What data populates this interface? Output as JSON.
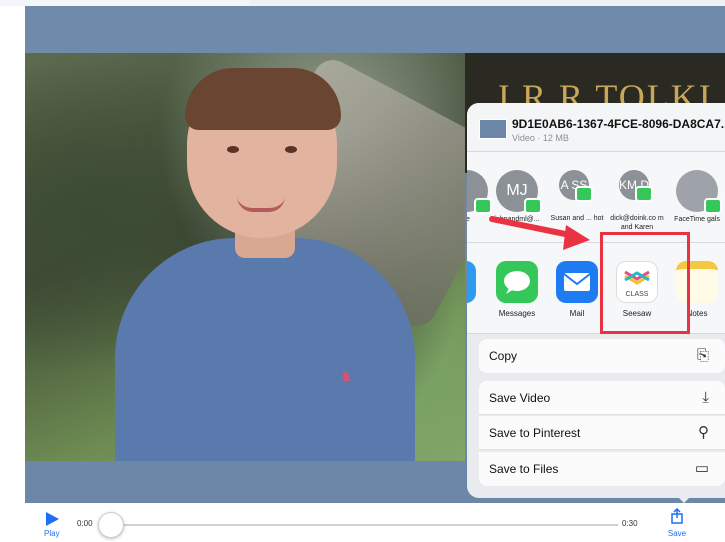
{
  "share_sheet": {
    "file_name": "9D1E0AB6-1367-4FCE-8096-DA8CA7...",
    "file_meta": "Video · 12 MB",
    "people": [
      {
        "initials": "",
        "label": "te"
      },
      {
        "initials": "MJ",
        "label": "johnandml@..."
      },
      {
        "initials": "A SS",
        "label": "Susan and ... hot"
      },
      {
        "initials": "KM D",
        "label": "dick@doink.co m and Karen"
      },
      {
        "initials": "",
        "label": "FaceTime gals"
      }
    ],
    "apps": [
      {
        "label": "Messages",
        "icon": "messages-icon"
      },
      {
        "label": "Mail",
        "icon": "mail-icon"
      },
      {
        "label": "Seesaw",
        "icon": "seesaw-icon",
        "icon_text": "CLASS"
      },
      {
        "label": "Notes",
        "icon": "notes-icon"
      }
    ],
    "actions": {
      "copy": "Copy",
      "save_video": "Save Video",
      "save_pinterest": "Save to Pinterest",
      "save_files": "Save to Files"
    }
  },
  "video_text": {
    "book_title": "J.R.R TOLKI"
  },
  "player": {
    "play_label": "Play",
    "time_start": "0:00",
    "time_end": "0:30",
    "save_label": "Save",
    "progress": 0
  },
  "colors": {
    "accent": "#1e6ff5",
    "highlight": "#ea3342",
    "message_badge": "#35c759"
  }
}
